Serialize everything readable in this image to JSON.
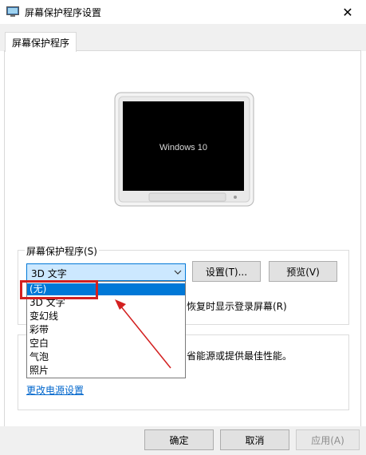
{
  "window": {
    "title": "屏幕保护程序设置",
    "close_glyph": "✕"
  },
  "tab": {
    "label": "屏幕保护程序"
  },
  "preview_monitor": {
    "screen_text": "Windows 10"
  },
  "screensaver_group": {
    "label": "屏幕保护程序(S)",
    "selected_value": "3D 文字",
    "settings_button": "设置(T)...",
    "preview_button": "预览(V)",
    "resume_checkbox_label_visible": "恢复时显示登录屏幕(R)",
    "dropdown_items": [
      "(无)",
      "3D 文字",
      "变幻线",
      "彩带",
      "空白",
      "气泡",
      "照片"
    ],
    "highlighted_index": 0
  },
  "power_group": {
    "partial_text": "省能源或提供最佳性能。",
    "link_text": "更改电源设置"
  },
  "footer": {
    "ok": "确定",
    "cancel": "取消",
    "apply": "应用(A)"
  },
  "colors": {
    "annotation": "#d32020",
    "selection": "#0078d7",
    "link": "#0066cc"
  }
}
